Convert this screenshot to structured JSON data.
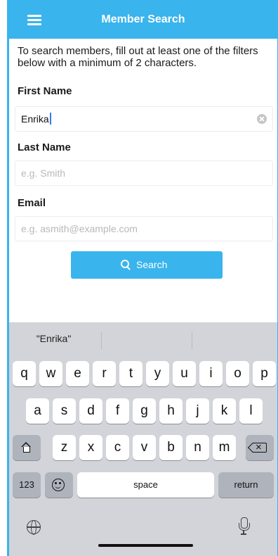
{
  "nav": {
    "title": "Member Search",
    "menu_icon": "hamburger-menu-icon"
  },
  "intro_text": "To search members, fill out at least one of the filters below with a minimum of 2 characters.",
  "fields": {
    "first_name": {
      "label": "First Name",
      "value": "Enrika",
      "placeholder": ""
    },
    "last_name": {
      "label": "Last Name",
      "value": "",
      "placeholder": "e.g. Smith"
    },
    "email": {
      "label": "Email",
      "value": "",
      "placeholder": "e.g. asmith@example.com"
    }
  },
  "search_button": {
    "label": "Search",
    "icon": "search-icon"
  },
  "keyboard": {
    "suggestions": [
      "\"Enrika\"",
      "",
      ""
    ],
    "row1": [
      "q",
      "w",
      "e",
      "r",
      "t",
      "y",
      "u",
      "i",
      "o",
      "p"
    ],
    "row2": [
      "a",
      "s",
      "d",
      "f",
      "g",
      "h",
      "j",
      "k",
      "l"
    ],
    "row3": [
      "z",
      "x",
      "c",
      "v",
      "b",
      "n",
      "m"
    ],
    "numbers_label": "123",
    "space_label": "space",
    "return_label": "return"
  },
  "colors": {
    "accent": "#39b4ec",
    "keyboard_bg": "#d2d4d9",
    "key_fn_bg": "#afb3bb"
  }
}
